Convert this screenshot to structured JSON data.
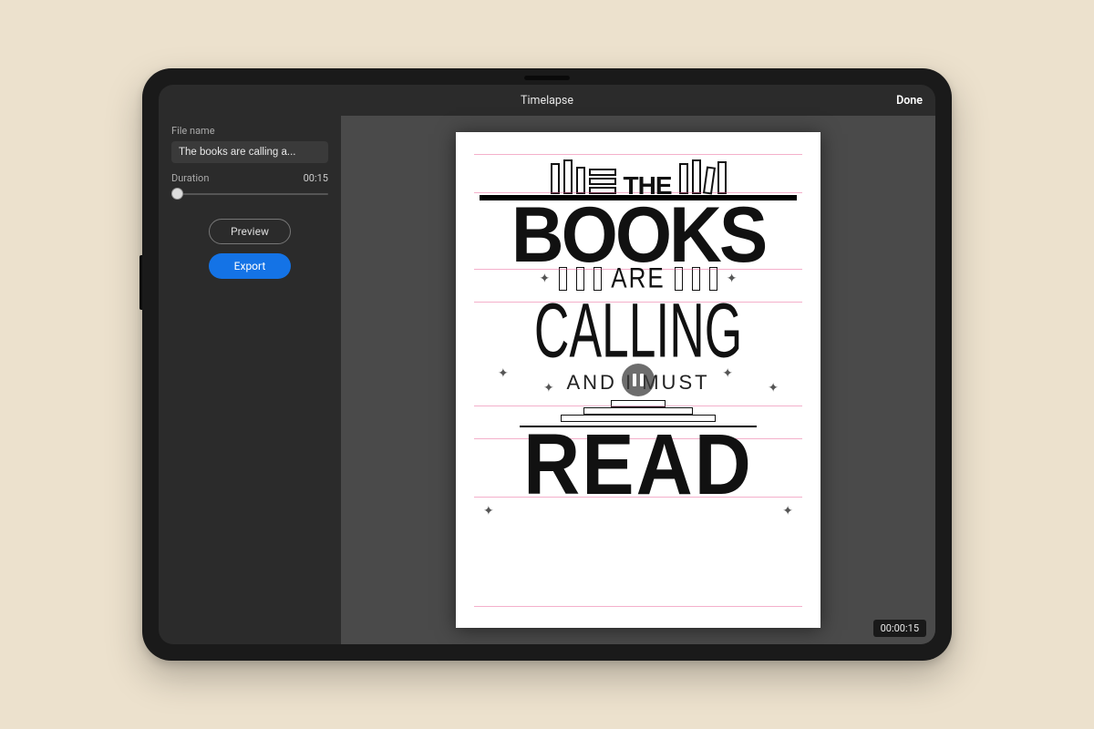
{
  "header": {
    "title": "Timelapse",
    "done": "Done"
  },
  "sidebar": {
    "filename_label": "File name",
    "filename_value": "The books are calling a...",
    "duration_label": "Duration",
    "duration_value": "00:15",
    "preview_label": "Preview",
    "export_label": "Export"
  },
  "canvas": {
    "timestamp": "00:00:15",
    "art": {
      "line1": "THE",
      "line2": "BOOKS",
      "line3": "ARE",
      "line4": "CALLING",
      "line5": "AND I MUST",
      "line6": "READ"
    }
  },
  "colors": {
    "accent": "#1473e6"
  }
}
